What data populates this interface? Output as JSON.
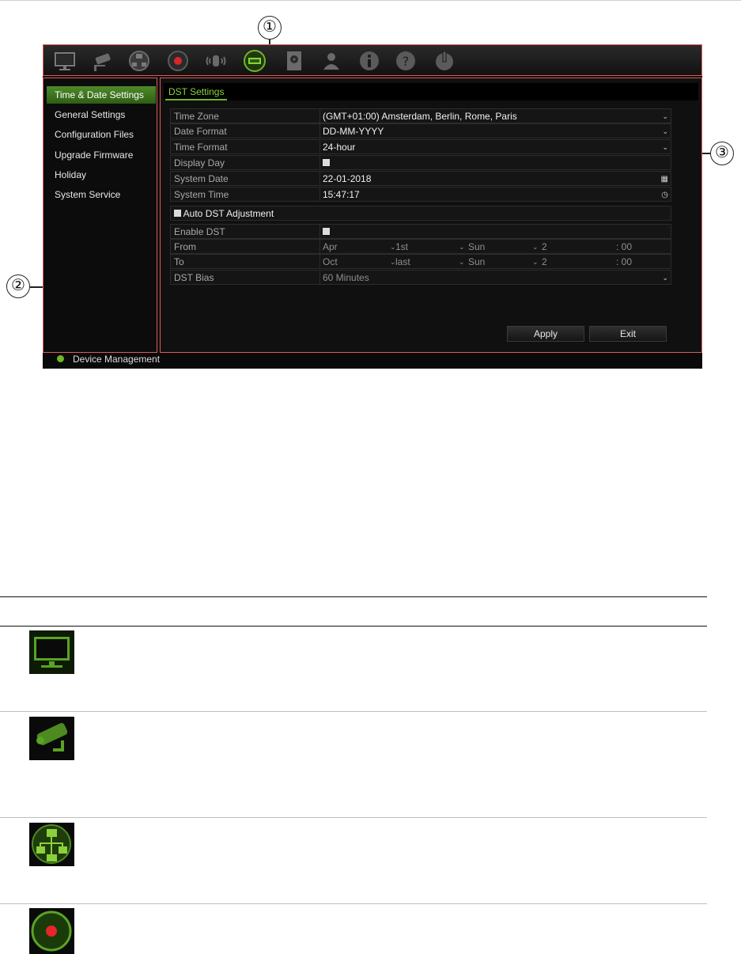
{
  "toolbar": {
    "icons": [
      "monitor-icon",
      "camera-icon",
      "network-icon",
      "record-icon",
      "alarm-icon",
      "device-icon",
      "storage-icon",
      "user-icon",
      "info-icon",
      "help-icon",
      "power-icon"
    ]
  },
  "callouts": {
    "one": "①",
    "two": "②",
    "three": "③"
  },
  "sidebar": {
    "items": [
      {
        "label": "Time & Date Settings",
        "active": true
      },
      {
        "label": "General Settings"
      },
      {
        "label": "Configuration Files"
      },
      {
        "label": "Upgrade Firmware"
      },
      {
        "label": "Holiday"
      },
      {
        "label": "System Service"
      }
    ]
  },
  "panel": {
    "tab": "DST Settings",
    "rows": [
      {
        "label": "Time Zone",
        "value": "(GMT+01:00) Amsterdam, Berlin, Rome, Paris"
      },
      {
        "label": "Date Format",
        "value": "DD-MM-YYYY"
      },
      {
        "label": "Time Format",
        "value": "24-hour"
      },
      {
        "label": "Display Day",
        "value": ""
      },
      {
        "label": "System Date",
        "value": "22-01-2018"
      },
      {
        "label": "System Time",
        "value": "15:47:17"
      }
    ],
    "auto_dst_label": "Auto DST Adjustment",
    "enable_dst_label": "Enable DST",
    "from": {
      "label": "From",
      "month": "Apr",
      "week": "1st",
      "day": "Sun",
      "hour": "2",
      "minute": ": 00"
    },
    "to": {
      "label": "To",
      "month": "Oct",
      "week": "last",
      "day": "Sun",
      "hour": "2",
      "minute": ": 00"
    },
    "bias": {
      "label": "DST Bias",
      "value": "60 Minutes"
    },
    "apply_label": "Apply",
    "exit_label": "Exit"
  },
  "bottom_bar": {
    "label": "Device Management"
  },
  "colors": {
    "accent": "#6db52a",
    "callout_border": "#e05a5a",
    "panel_bg": "#101010"
  }
}
